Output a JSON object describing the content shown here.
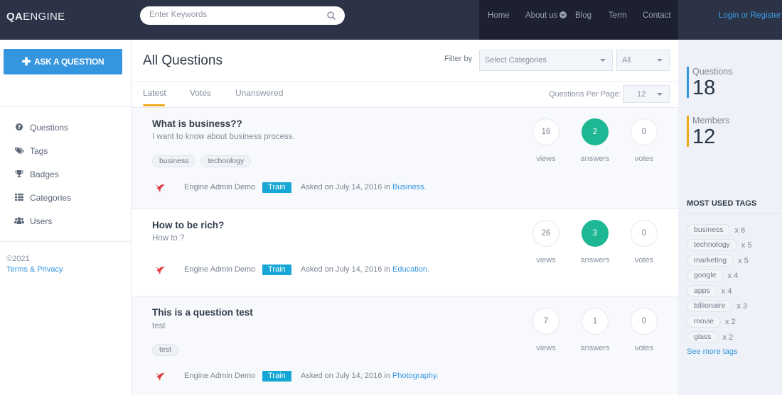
{
  "header": {
    "logo_bold": "QA",
    "logo_rest": "ENGINE",
    "search_placeholder": "Enter Keywords",
    "nav": [
      {
        "label": "Home"
      },
      {
        "label": "About us",
        "has_dropdown": true
      },
      {
        "label": "Blog"
      },
      {
        "label": "Term"
      },
      {
        "label": "Contact"
      }
    ],
    "login_label": "Login or Register"
  },
  "sidebar": {
    "ask_button": "ASK A QUESTION",
    "items": [
      {
        "label": "Questions",
        "icon": "question-circle-icon"
      },
      {
        "label": "Tags",
        "icon": "tags-icon"
      },
      {
        "label": "Badges",
        "icon": "trophy-icon"
      },
      {
        "label": "Categories",
        "icon": "list-icon"
      },
      {
        "label": "Users",
        "icon": "users-icon"
      }
    ],
    "copyright": "©2021",
    "terms_link": "Terms & Privacy"
  },
  "main": {
    "title": "All Questions",
    "filter_label": "Filter by",
    "category_select": "Select Categories",
    "type_select": "All",
    "tabs": [
      {
        "label": "Latest",
        "active": true
      },
      {
        "label": "Votes",
        "active": false
      },
      {
        "label": "Unanswered",
        "active": false
      }
    ],
    "per_page_label": "Questions Per Page:",
    "per_page_value": "12",
    "questions": [
      {
        "title": "What is business??",
        "excerpt": "I want to know about business process.",
        "tags": [
          "business",
          "technology"
        ],
        "author": "Engine Admin Demo",
        "badge": "Train",
        "asked_prefix": "Asked on July 14, 2016 in",
        "category": "Business.",
        "views": "16",
        "answers": "2",
        "votes": "0",
        "views_label": "views",
        "answers_label": "answers",
        "votes_label": "votes"
      },
      {
        "title": "How to be rich?",
        "excerpt": "How to ?",
        "tags": [],
        "author": "Engine Admin Demo",
        "badge": "Train",
        "asked_prefix": "Asked on July 14, 2016 in",
        "category": "Education.",
        "views": "26",
        "answers": "3",
        "votes": "0",
        "views_label": "views",
        "answers_label": "answers",
        "votes_label": "votes"
      },
      {
        "title": "This is a question test",
        "excerpt": "test",
        "tags": [
          "test"
        ],
        "author": "Engine Admin Demo",
        "badge": "Train",
        "asked_prefix": "Asked on July 14, 2016 in",
        "category": "Photography.",
        "views": "7",
        "answers": "1",
        "votes": "0",
        "views_label": "views",
        "answers_label": "answers",
        "votes_label": "votes"
      }
    ]
  },
  "rightbar": {
    "questions_label": "Questions",
    "questions_count": "18",
    "members_label": "Members",
    "members_count": "12",
    "most_used_title": "MOST USED TAGS",
    "tags": [
      {
        "name": "business",
        "count": "x 6"
      },
      {
        "name": "technology",
        "count": "x 5"
      },
      {
        "name": "marketing",
        "count": "x 5"
      },
      {
        "name": "google",
        "count": "x 4"
      },
      {
        "name": "apps",
        "count": "x 4"
      },
      {
        "name": "billionaire",
        "count": "x 3"
      },
      {
        "name": "movie",
        "count": "x 2"
      },
      {
        "name": "glass",
        "count": "x 2"
      }
    ],
    "see_more": "See more tags"
  },
  "colors": {
    "header_bg": "#2c3347",
    "nav_bg": "#1c2030",
    "primary": "#3596e0",
    "answered_green": "#1eb793",
    "tab_underline": "#f0a91b",
    "badge_blue": "#16a7d6",
    "questions_bar": "#3596e0",
    "members_bar": "#f0a91b"
  }
}
